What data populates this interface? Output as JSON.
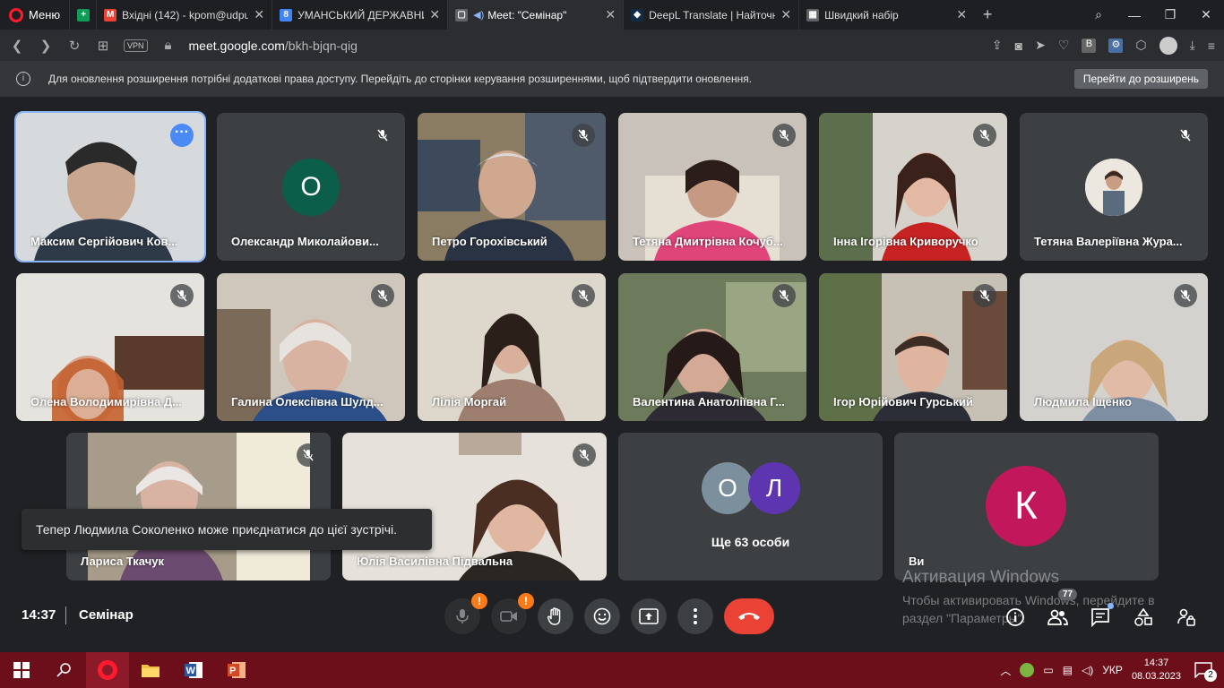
{
  "browser": {
    "menu_label": "Меню",
    "tabs": [
      {
        "title": "",
        "favicon": "plus-doc-icon",
        "color": "#0f9d58"
      },
      {
        "title": "Вхідні (142) - kpom@udpu",
        "favicon": "gmail-icon",
        "color": "#ea4335"
      },
      {
        "title": "УМАНСЬКИЙ ДЕРЖАВНИ",
        "favicon": "calendar-icon",
        "color": "#4285f4"
      },
      {
        "title": "Meet: \"Семінар\"",
        "favicon": "meet-icon",
        "color": "#00897b"
      },
      {
        "title": "DeepL Translate | Найточні",
        "favicon": "deepl-icon",
        "color": "#0f2b46"
      },
      {
        "title": "Швидкий набір",
        "favicon": "speed-dial-icon",
        "color": "#5f6368"
      }
    ],
    "url_domain": "meet.google.com",
    "url_path": "/bkh-bjqn-qig",
    "vpn_label": "VPN"
  },
  "infobar": {
    "message": "Для оновлення розширення потрібні додаткові права доступу. Перейдіть до сторінки керування розширеннями, щоб підтвердити оновлення.",
    "button_label": "Перейти до розширень"
  },
  "participants": [
    {
      "name": "Максим Сергійович Ков..."
    },
    {
      "name": "Олександр Миколайови...",
      "initial": "О"
    },
    {
      "name": "Петро Горохівський"
    },
    {
      "name": "Тетяна Дмитрівна Кочуб..."
    },
    {
      "name": "Інна Ігорівна Криворучко"
    },
    {
      "name": "Тетяна Валеріївна Жура..."
    },
    {
      "name": "Олена Володимирівна Д..."
    },
    {
      "name": "Галина Олексіївна Шулд..."
    },
    {
      "name": "Лілія Моргай"
    },
    {
      "name": "Валентина Анатоліївна Г..."
    },
    {
      "name": "Ігор Юрійович Гурський"
    },
    {
      "name": "Людмила Іщенко"
    },
    {
      "name": "Лариса Ткачук"
    },
    {
      "name": "Юлія Василівна Підвальна"
    }
  ],
  "others_tile": {
    "initials": [
      "О",
      "Л"
    ],
    "label": "Ще 63 особи"
  },
  "self_tile": {
    "initial": "К",
    "label": "Ви"
  },
  "toast": "Тепер Людмила Соколенко може приєднатися до цієї зустрічі.",
  "meeting": {
    "time": "14:37",
    "title": "Семінар",
    "people_count": "77"
  },
  "activation": {
    "title": "Активация Windows",
    "text": "Чтобы активировать Windows, перейдите в раздел \"Параметры\"."
  },
  "taskbar": {
    "lang": "УКР",
    "time": "14:37",
    "date": "08.03.2023",
    "notifications": "2"
  }
}
